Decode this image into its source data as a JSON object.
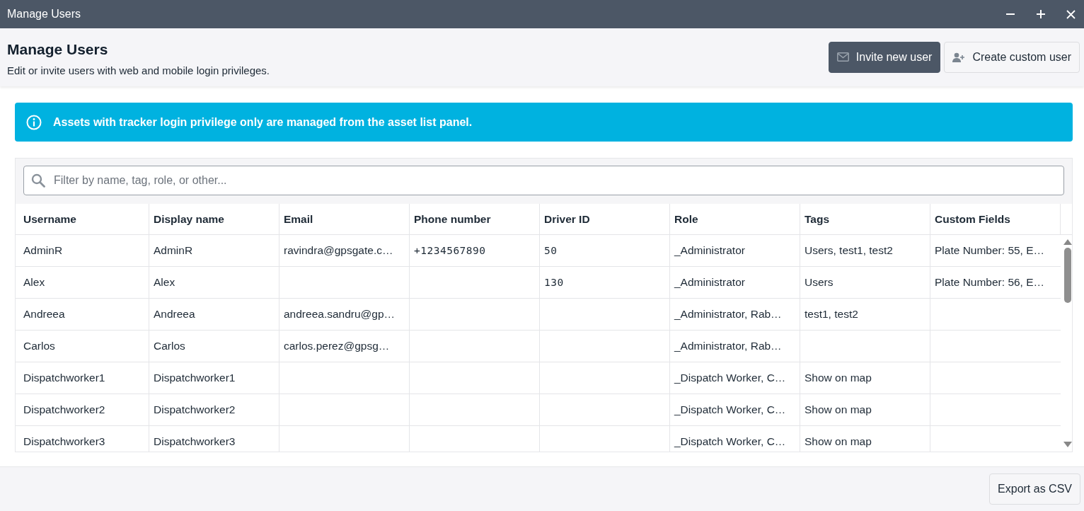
{
  "window": {
    "title": "Manage Users"
  },
  "header": {
    "title": "Manage Users",
    "subtitle": "Edit or invite users with web and mobile login privileges.",
    "buttons": [
      {
        "label": "Invite new user",
        "kind": "primary"
      },
      {
        "label": "Create custom user",
        "kind": "secondary"
      }
    ]
  },
  "banner": {
    "text": "Assets with tracker login privilege only are managed from the asset list panel."
  },
  "filter": {
    "placeholder": "Filter by name, tag, role, or other..."
  },
  "table": {
    "columns": [
      {
        "label": "Username",
        "kind": "text"
      },
      {
        "label": "Display name",
        "kind": "text"
      },
      {
        "label": "Email",
        "kind": "text"
      },
      {
        "label": "Phone number",
        "kind": "mono"
      },
      {
        "label": "Driver ID",
        "kind": "mono"
      },
      {
        "label": "Role",
        "kind": "text"
      },
      {
        "label": "Tags",
        "kind": "text"
      },
      {
        "label": "Custom Fields",
        "kind": "text"
      }
    ],
    "rows": [
      [
        "AdminR",
        "AdminR",
        "ravindra@gpsgate.c…",
        "+1234567890",
        "50",
        "_Administrator",
        "Users, test1, test2",
        "Plate Number: 55, E…"
      ],
      [
        "Alex",
        "Alex",
        "",
        "",
        "130",
        "_Administrator",
        "Users",
        "Plate Number: 56, E…"
      ],
      [
        "Andreea",
        "Andreea",
        "andreea.sandru@gp…",
        "",
        "",
        "_Administrator, Rab…",
        "test1, test2",
        ""
      ],
      [
        "Carlos",
        "Carlos",
        "carlos.perez@gpsg…",
        "",
        "",
        "_Administrator, Rab…",
        "",
        ""
      ],
      [
        "Dispatchworker1",
        "Dispatchworker1",
        "",
        "",
        "",
        "_Dispatch Worker, C…",
        "Show on map",
        ""
      ],
      [
        "Dispatchworker2",
        "Dispatchworker2",
        "",
        "",
        "",
        "_Dispatch Worker, C…",
        "Show on map",
        ""
      ],
      [
        "Dispatchworker3",
        "Dispatchworker3",
        "",
        "",
        "",
        "_Dispatch Worker, C…",
        "Show on map",
        ""
      ]
    ]
  },
  "footer": {
    "button": "Export as CSV"
  }
}
